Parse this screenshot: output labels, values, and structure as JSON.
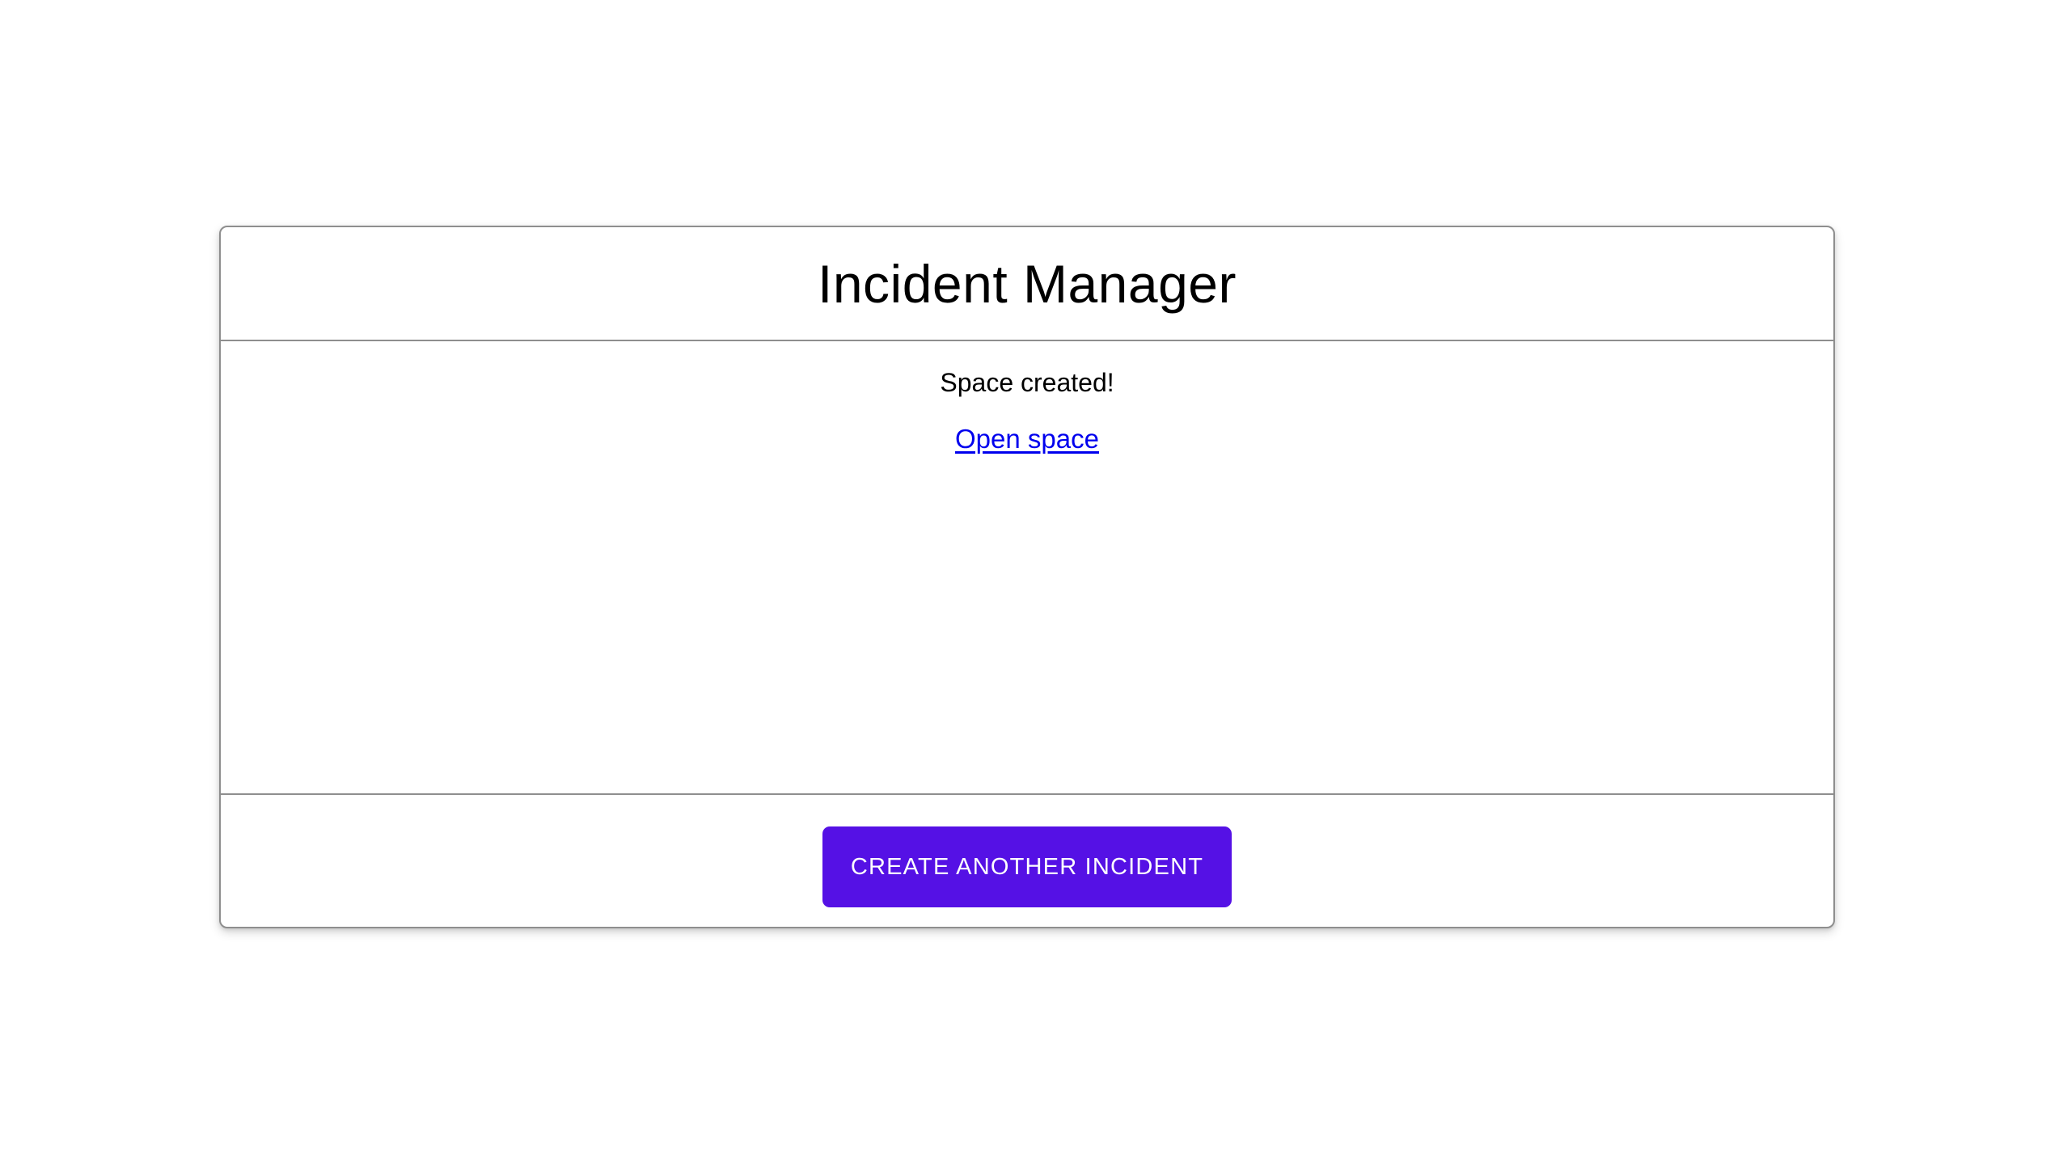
{
  "header": {
    "title": "Incident Manager"
  },
  "content": {
    "status_message": "Space created!",
    "open_space_link": "Open space"
  },
  "actions": {
    "create_button_label": "CREATE ANOTHER INCIDENT"
  },
  "colors": {
    "primary": "#5511E5",
    "link": "#0000EE",
    "border": "#8E8E8E",
    "text": "#000000",
    "button_text": "#FFFFFF",
    "page_background": "#FFFFFF"
  }
}
